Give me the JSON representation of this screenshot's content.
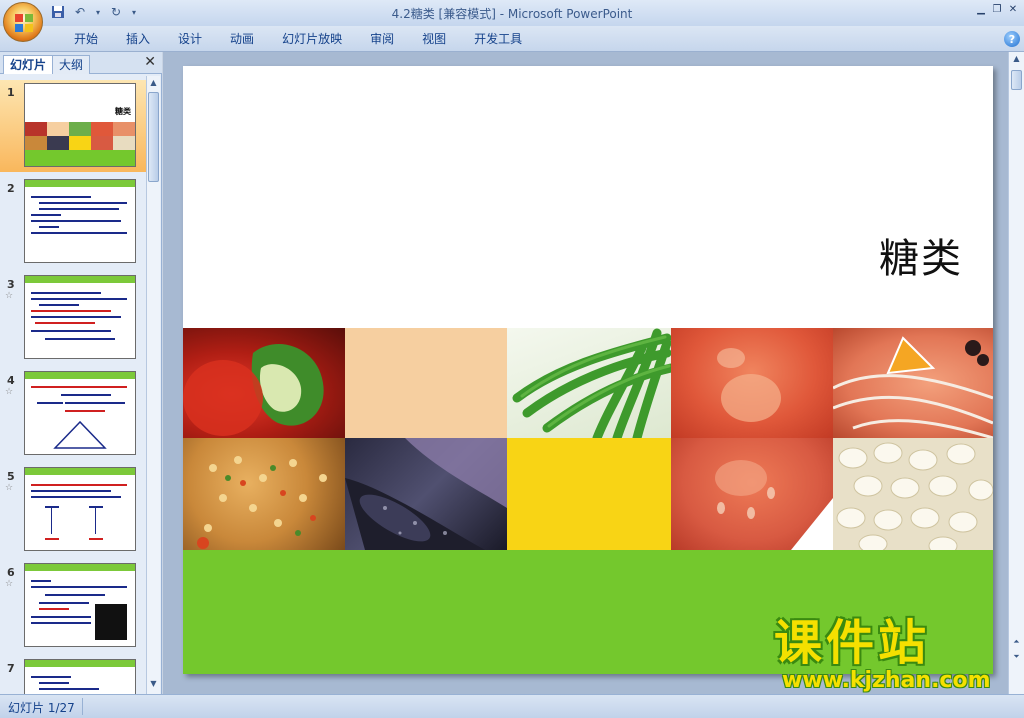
{
  "window": {
    "title_file": "4.2糖类 [兼容模式]",
    "title_sep": " - ",
    "title_app": "Microsoft PowerPoint"
  },
  "ribbon": {
    "tabs": [
      "开始",
      "插入",
      "设计",
      "动画",
      "幻灯片放映",
      "审阅",
      "视图",
      "开发工具"
    ]
  },
  "left_pane": {
    "tab_slides": "幻灯片",
    "tab_outline": "大纲",
    "thumbnails": [
      {
        "num": "1",
        "title": "糖类"
      },
      {
        "num": "2"
      },
      {
        "num": "3"
      },
      {
        "num": "4"
      },
      {
        "num": "5"
      },
      {
        "num": "6"
      },
      {
        "num": "7"
      }
    ]
  },
  "slide": {
    "title": "糖类"
  },
  "watermark": {
    "text": "课件站",
    "url": "www.kjzhan.com"
  },
  "status": {
    "slide_indicator": "幻灯片 1/27"
  },
  "colors": {
    "green_band": "#74c82d",
    "peach_tile": "#f6cfa0",
    "yellow_tile": "#f8d415",
    "selection": "#f9b75c"
  }
}
